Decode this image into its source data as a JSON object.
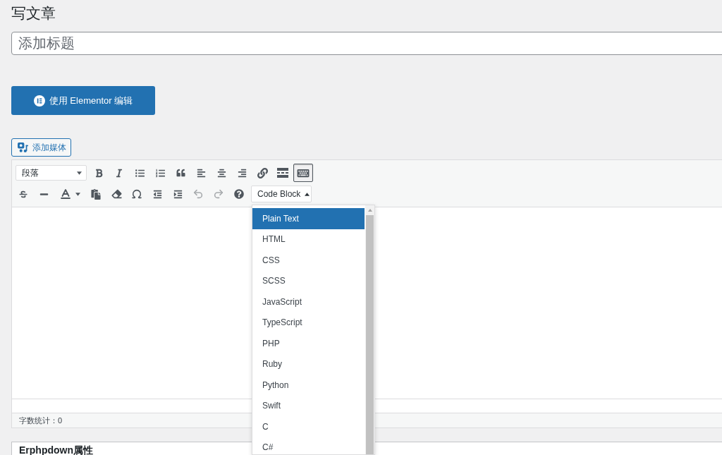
{
  "page": {
    "title": "写文章"
  },
  "title_field": {
    "placeholder": "添加标题"
  },
  "builder_button": {
    "label": "使用 Elementor 编辑"
  },
  "media_button": {
    "label": "添加媒体"
  },
  "editor": {
    "toolbar_rows": [
      {
        "format_select": {
          "value": "段落"
        },
        "tools": [
          {
            "kind": "bold",
            "pressed": false,
            "disabled": false
          },
          {
            "kind": "italic",
            "pressed": false,
            "disabled": false
          },
          {
            "kind": "bullet-list",
            "pressed": false,
            "disabled": false
          },
          {
            "kind": "numbered-list",
            "pressed": false,
            "disabled": false
          },
          {
            "kind": "blockquote",
            "pressed": false,
            "disabled": false
          },
          {
            "kind": "align-left",
            "pressed": false,
            "disabled": false
          },
          {
            "kind": "align-center",
            "pressed": false,
            "disabled": false
          },
          {
            "kind": "align-right",
            "pressed": false,
            "disabled": false
          },
          {
            "kind": "link",
            "pressed": false,
            "disabled": false
          },
          {
            "kind": "read-more",
            "pressed": false,
            "disabled": false
          },
          {
            "kind": "toolbar-toggle",
            "pressed": true,
            "disabled": false
          }
        ]
      },
      {
        "tools": [
          {
            "kind": "strikethrough",
            "pressed": false,
            "disabled": false
          },
          {
            "kind": "horizontal-line",
            "pressed": false,
            "disabled": false
          },
          {
            "kind": "text-color",
            "pressed": false,
            "disabled": false
          },
          {
            "kind": "paste-text",
            "pressed": false,
            "disabled": false
          },
          {
            "kind": "clear-formatting",
            "pressed": false,
            "disabled": false
          },
          {
            "kind": "special-character",
            "pressed": false,
            "disabled": false
          },
          {
            "kind": "outdent",
            "pressed": false,
            "disabled": false
          },
          {
            "kind": "indent",
            "pressed": false,
            "disabled": false
          },
          {
            "kind": "undo",
            "pressed": false,
            "disabled": true
          },
          {
            "kind": "redo",
            "pressed": false,
            "disabled": true
          },
          {
            "kind": "help",
            "pressed": false,
            "disabled": false
          }
        ],
        "code_block": {
          "label": "Code Block",
          "expanded": true,
          "options": [
            {
              "label": "Plain Text",
              "selected": true
            },
            {
              "label": "HTML",
              "selected": false
            },
            {
              "label": "CSS",
              "selected": false
            },
            {
              "label": "SCSS",
              "selected": false
            },
            {
              "label": "JavaScript",
              "selected": false
            },
            {
              "label": "TypeScript",
              "selected": false
            },
            {
              "label": "PHP",
              "selected": false
            },
            {
              "label": "Ruby",
              "selected": false
            },
            {
              "label": "Python",
              "selected": false
            },
            {
              "label": "Swift",
              "selected": false
            },
            {
              "label": "C",
              "selected": false
            },
            {
              "label": "C#",
              "selected": false
            }
          ]
        }
      }
    ],
    "word_count": "字数统计：0"
  },
  "panels": [
    {
      "title": "Erphpdown属性"
    }
  ]
}
